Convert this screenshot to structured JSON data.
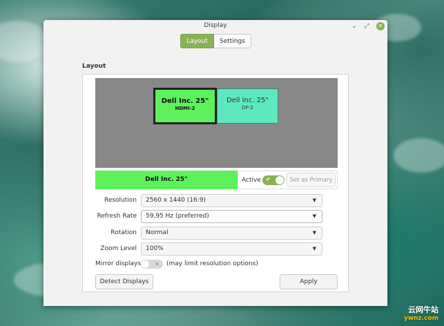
{
  "window": {
    "title": "Display",
    "controls": {
      "minimize": "⌄",
      "restore": "⤢",
      "close": "✕"
    }
  },
  "tabs": [
    {
      "label": "Layout",
      "active": true
    },
    {
      "label": "Settings",
      "active": false
    }
  ],
  "section_title": "Layout",
  "monitors": [
    {
      "name": "Dell Inc. 25\"",
      "port": "HDMI-2",
      "color": "#5df25c",
      "selected": true
    },
    {
      "name": "Dell Inc. 25\"",
      "port": "DP-2",
      "color": "#5de8c0",
      "selected": false
    }
  ],
  "selected_monitor": {
    "name": "Dell Inc. 25\"",
    "active_label": "Active",
    "active": true,
    "set_primary_label": "Set as Primary"
  },
  "settings": {
    "resolution": {
      "label": "Resolution",
      "value": "2560 x 1440 (16:9)"
    },
    "refresh_rate": {
      "label": "Refresh Rate",
      "value": "59,95 Hz (preferred)"
    },
    "rotation": {
      "label": "Rotation",
      "value": "Normal"
    },
    "zoom_level": {
      "label": "Zoom Level",
      "value": "100%"
    }
  },
  "mirror": {
    "label": "Mirror displays",
    "enabled": false,
    "note": "(may limit resolution options)"
  },
  "buttons": {
    "detect": "Detect Displays",
    "apply": "Apply"
  },
  "watermark": {
    "line1": "云网牛站",
    "line2": "ywnz.com"
  },
  "colors": {
    "accent": "#8bb158",
    "primary_monitor": "#5df25c",
    "secondary_monitor": "#5de8c0",
    "canvas": "#888888"
  }
}
